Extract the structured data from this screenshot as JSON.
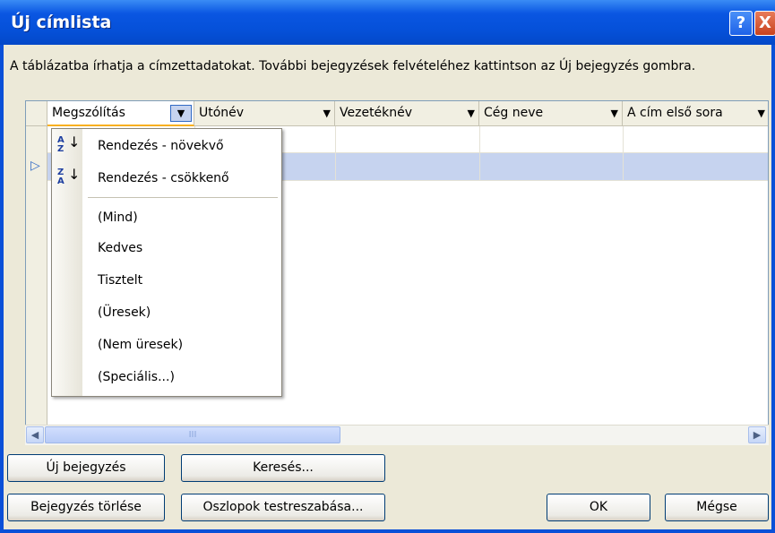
{
  "window": {
    "title": "Új címlista",
    "help_label": "?",
    "close_label": "X"
  },
  "instructions": "A táblázatba írhatja a címzettadatokat. További bejegyzések felvételéhez kattintson az Új bejegyzés gombra.",
  "grid": {
    "columns": [
      {
        "label": "Megszólítás"
      },
      {
        "label": "Utónév"
      },
      {
        "label": "Vezetéknév"
      },
      {
        "label": "Cég neve"
      },
      {
        "label": "A cím első sora"
      }
    ],
    "dropdown_arrow": "▼",
    "row_marker": "▷"
  },
  "filter_menu": {
    "sort_ascending": "Rendezés - növekvő",
    "sort_descending": "Rendezés - csökkenő",
    "options": [
      "(Mind)",
      "Kedves",
      "Tisztelt",
      "(Üresek)",
      "(Nem üresek)",
      "(Speciális...)"
    ],
    "sort_ascending_icon": {
      "top": "A",
      "bottom": "Z",
      "icon": "sort-ascending-icon"
    },
    "sort_descending_icon": {
      "top": "Z",
      "bottom": "A",
      "icon": "sort-descending-icon"
    }
  },
  "scrollbar": {
    "left_arrow": "◀",
    "right_arrow": "▶",
    "grip": "III"
  },
  "buttons": {
    "new_entry": "Új bejegyzés",
    "search": "Keresés...",
    "delete_entry": "Bejegyzés törlése",
    "customize_columns": "Oszlopok testreszabása...",
    "ok": "OK",
    "cancel": "Mégse"
  },
  "colors": {
    "titlebar": "#0550D8",
    "selection": "#C6D3EF",
    "face": "#ECE9D8"
  }
}
